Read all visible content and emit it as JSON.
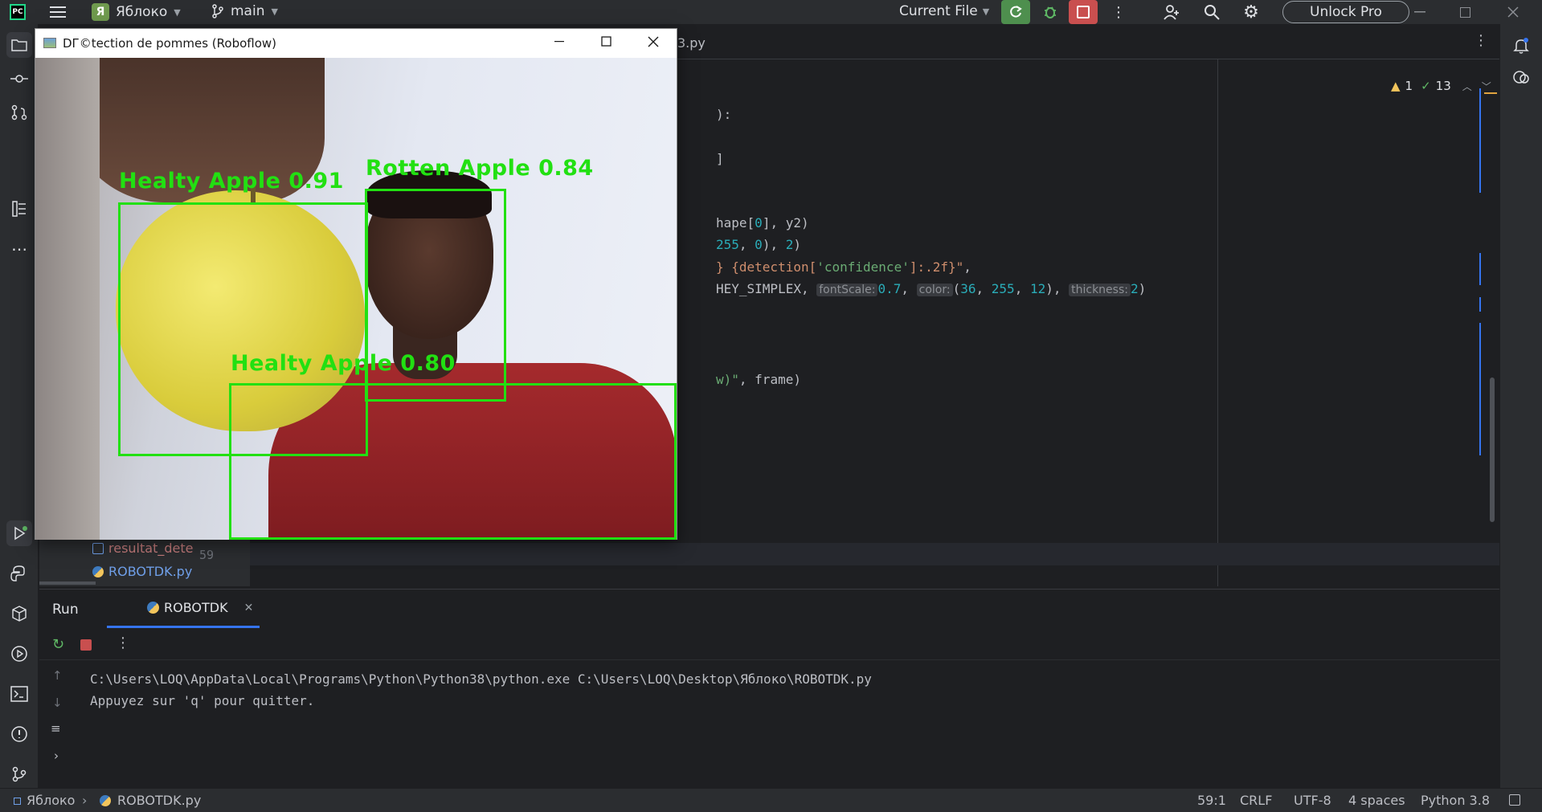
{
  "titlebar": {
    "project_initial": "Я",
    "project_name": "Яблоко",
    "branch": "main",
    "run_config": "Current File",
    "unlock_label": "Unlock Pro"
  },
  "editor": {
    "tab_fragment": "3.py",
    "warnings": "1",
    "checks": "13",
    "line_number": "59",
    "code": {
      "l1": "):",
      "l2": "]",
      "l3a": "hape[",
      "l3b": "0",
      "l3c": "], y2)",
      "l4a": "255",
      "l4b": ", ",
      "l4c": "0",
      "l4d": "), ",
      "l4e": "2",
      "l4f": ")",
      "l5a": "} {detection[",
      "l5b": "'confidence'",
      "l5c": "]:.2f}\"",
      "l5d": ",",
      "l6a": "HEY_SIMPLEX, ",
      "l6_hint1": "fontScale:",
      "l6b": "0.7",
      "l6c": ", ",
      "l6_hint2": "color:",
      "l6d": "(",
      "l6e": "36",
      "l6f": ", ",
      "l6g": "255",
      "l6h": ", ",
      "l6i": "12",
      "l6j": "), ",
      "l6_hint3": "thickness:",
      "l6k": "2",
      "l6l": ")",
      "l7a": "w)\"",
      "l7b": ", frame)"
    }
  },
  "project_tree": {
    "items": [
      "resultat_dete",
      "ROBOTDK.py"
    ]
  },
  "cv_window": {
    "title": "DГ©tection de pommes (Roboflow)",
    "detections": [
      {
        "label": "Healty Apple 0.91"
      },
      {
        "label": "Rotten Apple 0.84"
      },
      {
        "label": "Healty Apple 0.80"
      }
    ]
  },
  "run_panel": {
    "tab_run": "Run",
    "tab_config": "ROBOTDK",
    "output": [
      "C:\\Users\\LOQ\\AppData\\Local\\Programs\\Python\\Python38\\python.exe C:\\Users\\LOQ\\Desktop\\Яблоко\\ROBOTDK.py",
      "Appuyez sur 'q' pour quitter."
    ]
  },
  "statusbar": {
    "project": "Яблоко",
    "file": "ROBOTDK.py",
    "position": "59:1",
    "line_sep": "CRLF",
    "encoding": "UTF-8",
    "indent": "4 spaces",
    "interpreter": "Python 3.8"
  },
  "colors": {
    "detection_green": "#22e012",
    "run_green": "#4e8f4e",
    "stop_red": "#c94f4f"
  }
}
